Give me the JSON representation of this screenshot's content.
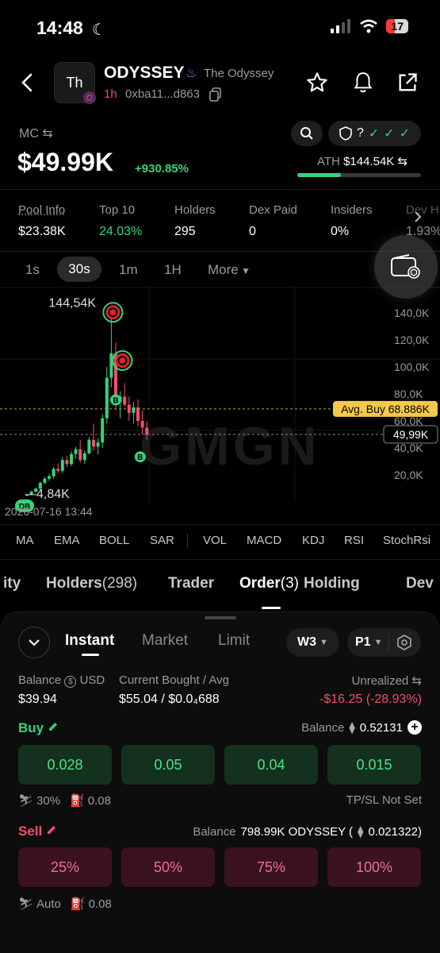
{
  "status": {
    "time": "14:48",
    "battery": "17"
  },
  "token": {
    "avatar_text": "Th",
    "name": "ODYSSEY",
    "full_name": "The Odyssey",
    "age": "1h",
    "address": "0xba11...d863"
  },
  "market": {
    "mc_label": "MC ⇆",
    "mc_value": "$49.99K",
    "mc_change": "+930.85%",
    "ath_label": "ATH",
    "ath_value": "$144.54K ⇆",
    "ath_progress": 0.35,
    "security": "?"
  },
  "stats": [
    {
      "label": "Pool Info",
      "value": "$23.38K",
      "color": "#ffffff"
    },
    {
      "label": "Top 10",
      "value": "24.03%",
      "color": "#36d27a"
    },
    {
      "label": "Holders",
      "value": "295",
      "color": "#ffffff"
    },
    {
      "label": "Dex Paid",
      "value": "0",
      "color": "#ffffff"
    },
    {
      "label": "Insiders",
      "value": "0%",
      "color": "#ffffff"
    },
    {
      "label": "Dev H",
      "value": "1.93%",
      "color": "#ffffff"
    }
  ],
  "timeframes": {
    "t1": "1s",
    "t2": "30s",
    "t3": "1m",
    "t4": "1H",
    "more": "More"
  },
  "chart_data": {
    "type": "candlestick",
    "y_ticks": [
      "140,0K",
      "120,0K",
      "100,0K",
      "80,0K",
      "60,0K",
      "40,0K",
      "20,0K"
    ],
    "high_label": "144,54K",
    "low_label": "4,84K",
    "avg_buy_label": "Avg. Buy 68.886K",
    "current_label": "49,99K",
    "date_label": "2026-07-16 13:44",
    "watermark": "GMGN",
    "markers": {
      "buy": "B",
      "dev": "DB"
    },
    "ylim": [
      0,
      160000
    ],
    "avg_buy": 68886,
    "current": 49990,
    "candles": [
      [
        4840,
        6000,
        4200,
        5500
      ],
      [
        5500,
        8200,
        5000,
        7600
      ],
      [
        7600,
        10500,
        7000,
        9800
      ],
      [
        9800,
        15000,
        9000,
        14200
      ],
      [
        14200,
        18500,
        13000,
        17200
      ],
      [
        17200,
        21000,
        15500,
        19000
      ],
      [
        19000,
        26000,
        17000,
        24500
      ],
      [
        24500,
        28500,
        21500,
        23000
      ],
      [
        23000,
        33000,
        21500,
        31000
      ],
      [
        31000,
        34000,
        26000,
        28000
      ],
      [
        28000,
        37500,
        26500,
        35500
      ],
      [
        35500,
        41000,
        32000,
        39000
      ],
      [
        39000,
        46000,
        29000,
        31000
      ],
      [
        31000,
        38000,
        28000,
        36000
      ],
      [
        36000,
        48000,
        35000,
        46000
      ],
      [
        46000,
        58000,
        38000,
        41000
      ],
      [
        41000,
        47000,
        35000,
        44000
      ],
      [
        44000,
        65000,
        40000,
        62000
      ],
      [
        62000,
        100000,
        58000,
        92000
      ],
      [
        92000,
        144540,
        85000,
        110000
      ],
      [
        110000,
        118000,
        68000,
        74000
      ],
      [
        74000,
        82000,
        62000,
        78000
      ],
      [
        78000,
        88000,
        70000,
        72000
      ],
      [
        72000,
        78000,
        60000,
        66000
      ],
      [
        66000,
        74000,
        58000,
        70000
      ],
      [
        70000,
        76000,
        56000,
        60000
      ],
      [
        60000,
        68000,
        50000,
        55000
      ],
      [
        55000,
        60000,
        46000,
        49990
      ]
    ]
  },
  "indicators": [
    "MA",
    "EMA",
    "BOLL",
    "SAR",
    "VOL",
    "MACD",
    "KDJ",
    "RSI",
    "StochRsi"
  ],
  "tabs": {
    "activity": "ity",
    "holders": "Holders",
    "holders_count": "(298)",
    "trader": "Trader",
    "order": "Order",
    "order_count": "(3)",
    "holding": "Holding",
    "dev": "Dev"
  },
  "order_panel": {
    "tabs": {
      "instant": "Instant",
      "market": "Market",
      "limit": "Limit"
    },
    "wallet": "W3",
    "preset": "P1",
    "balance_label": "Balance",
    "balance_unit": "USD",
    "balance_value": "$39.94",
    "bought_label": "Current Bought",
    "avg_label": "Avg",
    "bought_value": "$55.04",
    "avg_value": "$0.0₄688",
    "unrealized_label": "Unrealized ⇆",
    "unrealized_value": "-$16.25",
    "unrealized_pct": "(-28.93%)"
  },
  "buy": {
    "label": "Buy",
    "balance_label": "Balance",
    "balance_value": "0.52131",
    "amounts": [
      "0.028",
      "0.05",
      "0.04",
      "0.015"
    ],
    "slippage": "30%",
    "gas": "0.08",
    "tpsl": "TP/SL Not Set"
  },
  "sell": {
    "label": "Sell",
    "balance_label": "Balance",
    "balance_value": "798.99K ODYSSEY (",
    "balance_eth": "0.021322)",
    "amounts": [
      "25%",
      "50%",
      "75%",
      "100%"
    ],
    "slippage": "Auto",
    "gas": "0.08"
  },
  "colors": {
    "green": "#36d27a",
    "red": "#f0506e",
    "avg_buy": "#f5c84b"
  }
}
